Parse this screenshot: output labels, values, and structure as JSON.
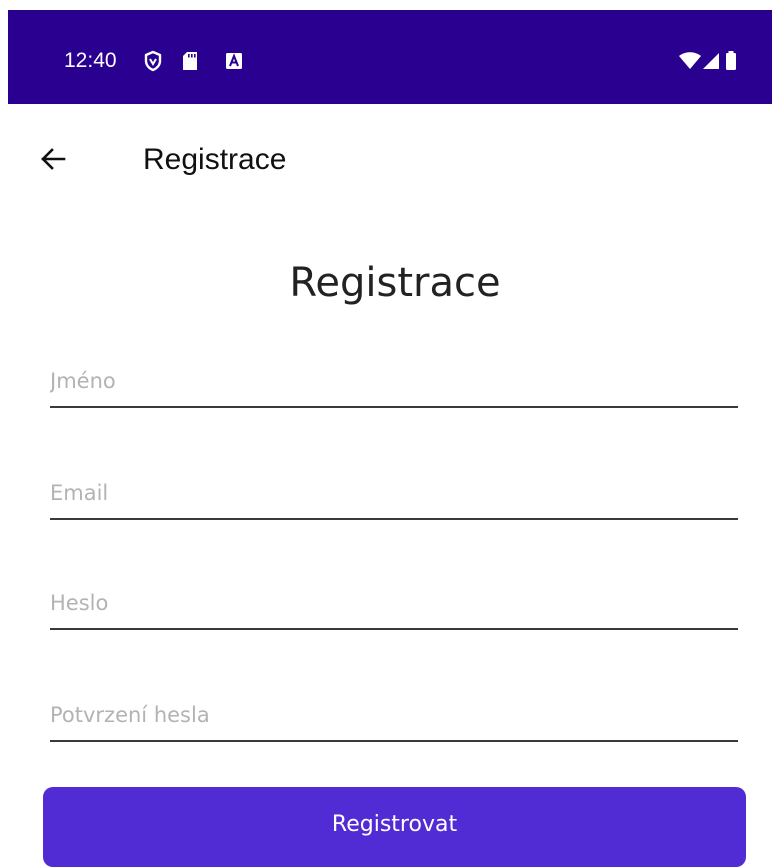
{
  "status_bar": {
    "time": "12:40",
    "background": "#2a0090",
    "left_icons": [
      "shield-icon",
      "sd-card-icon",
      "a-badge-icon"
    ],
    "right_icons": [
      "wifi-icon",
      "signal-icon",
      "battery-icon"
    ]
  },
  "app_bar": {
    "back_icon": "arrow-left-icon",
    "title": "Registrace"
  },
  "form": {
    "heading": "Registrace",
    "fields": [
      {
        "placeholder": "Jméno",
        "value": ""
      },
      {
        "placeholder": "Email",
        "value": ""
      },
      {
        "placeholder": "Heslo",
        "value": ""
      },
      {
        "placeholder": "Potvrzení hesla",
        "value": ""
      }
    ],
    "submit_label": "Registrovat",
    "accent_color": "#512bd4"
  }
}
